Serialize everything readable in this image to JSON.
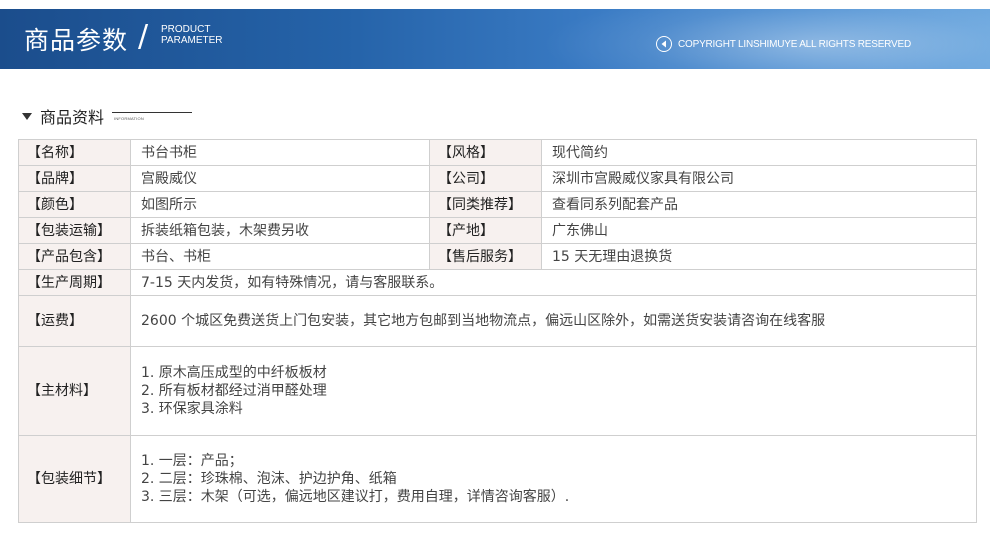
{
  "header": {
    "title": "商品参数",
    "slash": "/",
    "subtitle_line1": "PRODUCT",
    "subtitle_line2": "PARAMETER",
    "copyright": "COPYRIGHT LINSHIMUYE ALL RIGHTS RESERVED"
  },
  "section": {
    "title": "商品资料",
    "small_label": "INFORMATION"
  },
  "pairs": [
    {
      "k1": "【名称】",
      "v1": "书台书柜",
      "k2": "【风格】",
      "v2": "现代简约"
    },
    {
      "k1": "【品牌】",
      "v1": "宫殿威仪",
      "k2": "【公司】",
      "v2": "深圳市宫殿威仪家具有限公司"
    },
    {
      "k1": "【颜色】",
      "v1": "如图所示",
      "k2": "【同类推荐】",
      "v2": "查看同系列配套产品"
    },
    {
      "k1": "【包装运输】",
      "v1": "拆装纸箱包装，木架费另收",
      "k2": "【产地】",
      "v2": "广东佛山"
    },
    {
      "k1": "【产品包含】",
      "v1": "书台、书柜",
      "k2": "【售后服务】",
      "v2": "15 天无理由退换货"
    }
  ],
  "cycle": {
    "k": "【生产周期】",
    "v": "7-15 天内发货，如有特殊情况，请与客服联系。"
  },
  "freight": {
    "k": "【运费】",
    "v": "2600 个城区免费送货上门包安装，其它地方包邮到当地物流点，偏远山区除外，如需送货安装请咨询在线客服"
  },
  "material": {
    "k": "【主材料】",
    "lines": [
      "1. 原木高压成型的中纤板板材",
      "2. 所有板材都经过消甲醛处理",
      "3. 环保家具涂料"
    ]
  },
  "packing": {
    "k": "【包装细节】",
    "lines": [
      "1. 一层：产品；",
      "2. 二层：珍珠棉、泡沫、护边护角、纸箱",
      "3. 三层：木架（可选，偏远地区建议打，费用自理，详情咨询客服）."
    ]
  }
}
